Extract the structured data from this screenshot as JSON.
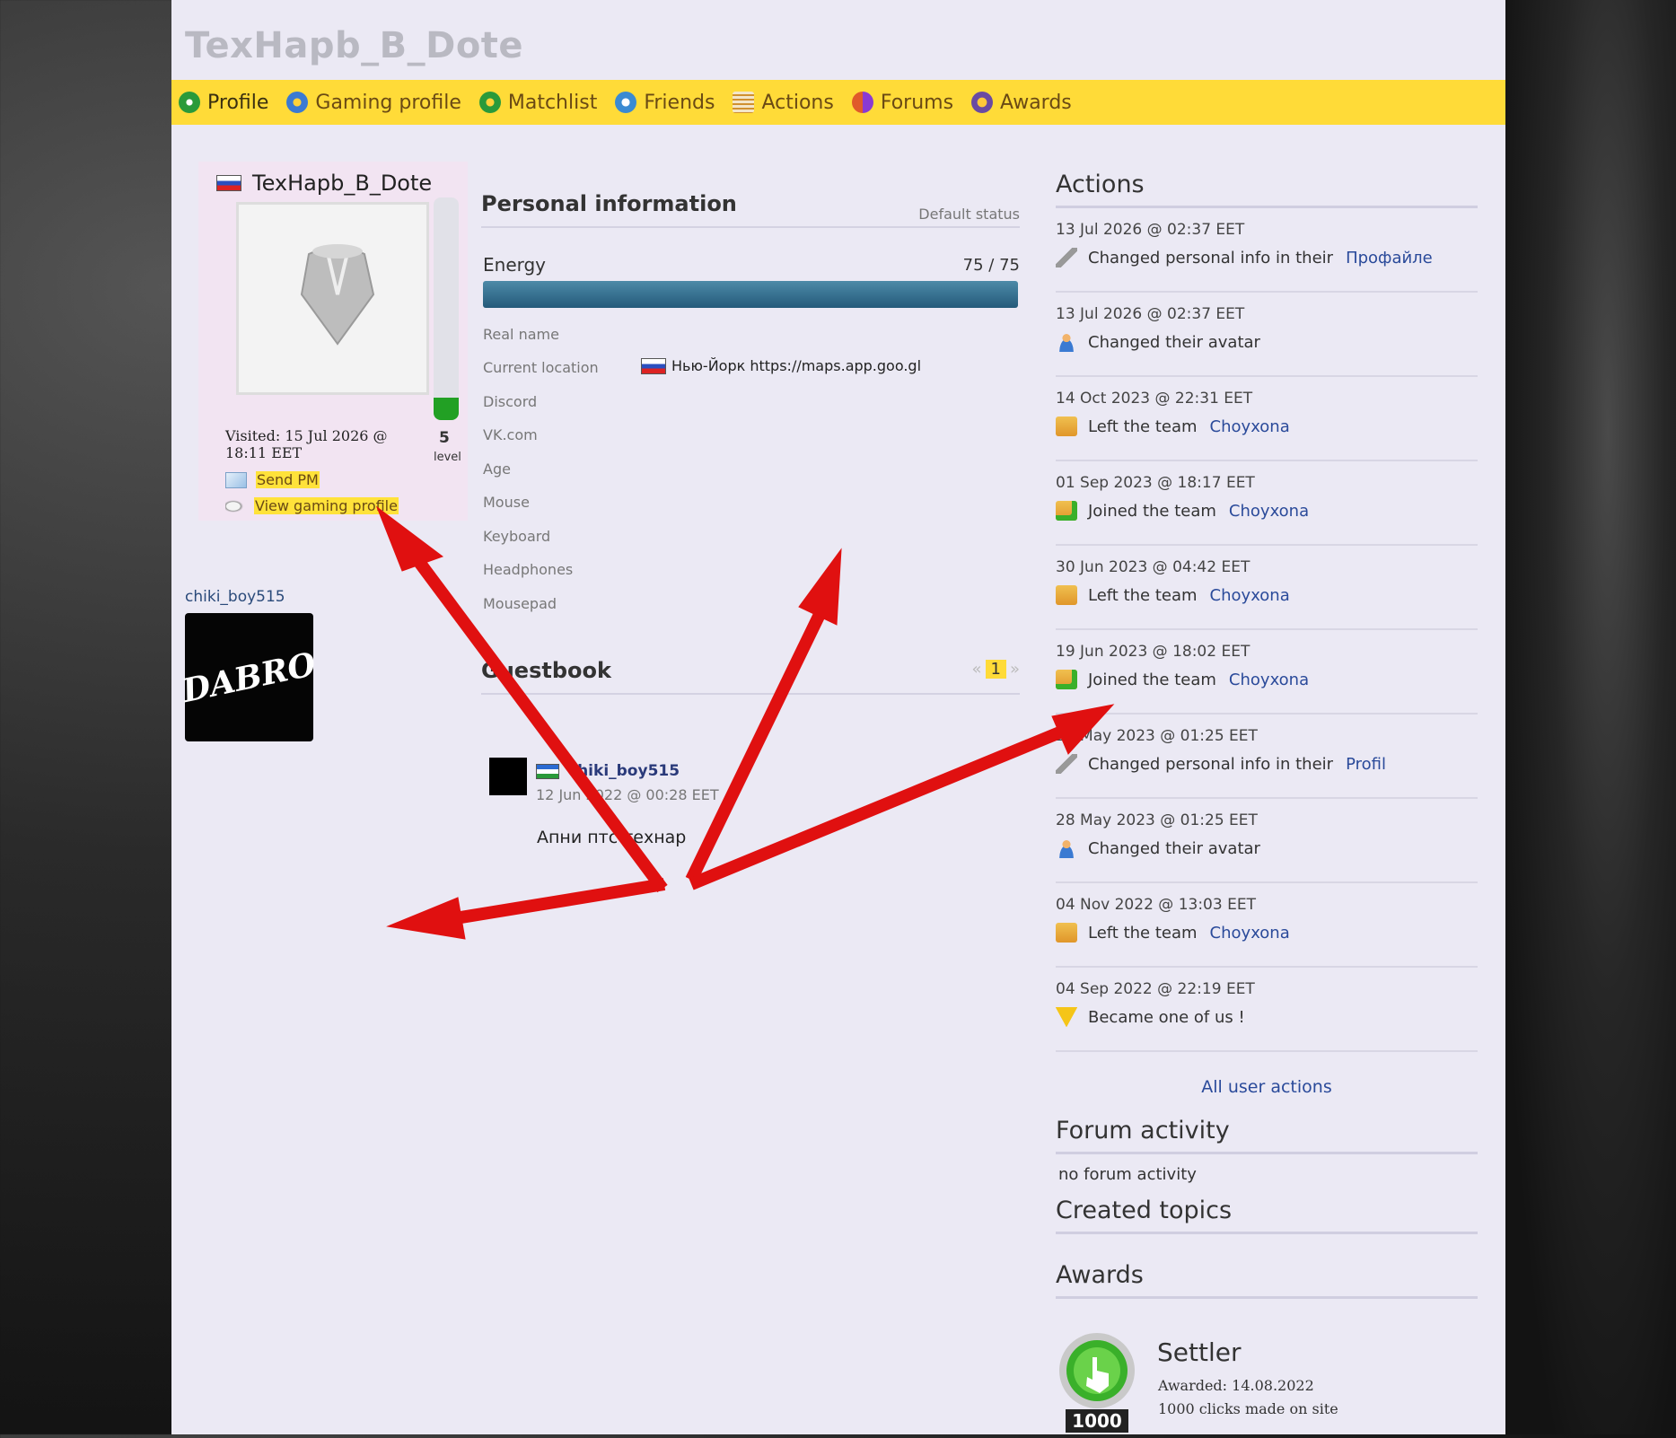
{
  "site_title": "TexHapb_B_Dote",
  "nav": [
    {
      "label": "Profile",
      "icon": "profile-icon"
    },
    {
      "label": "Gaming profile",
      "icon": "gaming-profile-icon"
    },
    {
      "label": "Matchlist",
      "icon": "matchlist-icon"
    },
    {
      "label": "Friends",
      "icon": "friends-icon"
    },
    {
      "label": "Actions",
      "icon": "actions-icon"
    },
    {
      "label": "Forums",
      "icon": "forums-icon"
    },
    {
      "label": "Awards",
      "icon": "awards-icon"
    }
  ],
  "profile": {
    "username": "TexHapb_B_Dote",
    "level": "5",
    "level_caption": "level",
    "level_fill_fraction": 0.1,
    "visited": "Visited: 15 Jul 2026 @ 18:11 EET",
    "send_pm": "Send PM",
    "view_gaming_profile": "View gaming profile"
  },
  "friend": {
    "name": "chiki_boy515",
    "avatar_text": "DABRO"
  },
  "personal": {
    "title": "Personal information",
    "status": "Default status",
    "energy_label": "Energy",
    "energy_value": "75 / 75",
    "energy_fraction": 1.0,
    "fields": [
      {
        "label": "Real name",
        "value": ""
      },
      {
        "label": "Current location",
        "value": "Нью-Йорк https://maps.app.goo.gl"
      },
      {
        "label": "Discord",
        "value": ""
      },
      {
        "label": "VK.com",
        "value": ""
      },
      {
        "label": "Age",
        "value": ""
      },
      {
        "label": "Mouse",
        "value": ""
      },
      {
        "label": "Keyboard",
        "value": ""
      },
      {
        "label": "Headphones",
        "value": ""
      },
      {
        "label": "Mousepad",
        "value": ""
      }
    ]
  },
  "guestbook": {
    "title": "Guestbook",
    "page_prev": "«",
    "page_current": "1",
    "page_next": "»",
    "entry": {
      "user": "chiki_boy515",
      "date": "12 Jun 2022 @ 00:28 EET",
      "text": "Апни птс технар"
    }
  },
  "actions": {
    "title": "Actions",
    "items": [
      {
        "date": "13 Jul 2026 @ 02:37 EET",
        "text": "Changed personal info in their",
        "link": "Профайле",
        "icon": "wrench-icon"
      },
      {
        "date": "13 Jul 2026 @ 02:37 EET",
        "text": "Changed their avatar",
        "link": "",
        "icon": "user-icon"
      },
      {
        "date": "14 Oct 2023 @ 22:31 EET",
        "text": "Left the team",
        "link": "Choyxona",
        "icon": "team-leave-icon"
      },
      {
        "date": "01 Sep 2023 @ 18:17 EET",
        "text": "Joined the team",
        "link": "Choyxona",
        "icon": "team-join-icon"
      },
      {
        "date": "30 Jun 2023 @ 04:42 EET",
        "text": "Left the team",
        "link": "Choyxona",
        "icon": "team-leave-icon"
      },
      {
        "date": "19 Jun 2023 @ 18:02 EET",
        "text": "Joined the team",
        "link": "Choyxona",
        "icon": "team-join-icon"
      },
      {
        "date": "28 May 2023 @ 01:25 EET",
        "text": "Changed personal info in their",
        "link": "Profil",
        "icon": "wrench-icon"
      },
      {
        "date": "28 May 2023 @ 01:25 EET",
        "text": "Changed their avatar",
        "link": "",
        "icon": "user-icon"
      },
      {
        "date": "04 Nov 2022 @ 13:03 EET",
        "text": "Left the team",
        "link": "Choyxona",
        "icon": "team-leave-icon"
      },
      {
        "date": "04 Sep 2022 @ 22:19 EET",
        "text": "Became one of us  !",
        "link": "",
        "icon": "warning-icon"
      }
    ],
    "all_link": "All user actions"
  },
  "forum": {
    "title": "Forum activity",
    "empty": "no forum activity",
    "created_topics_title": "Created topics"
  },
  "awards": {
    "title": "Awards",
    "item": {
      "name": "Settler",
      "awarded": "Awarded: 14.08.2022",
      "description": "1000 clicks made on site",
      "badge_number": "1000"
    }
  },
  "colors": {
    "nav_bg": "#ffdb38",
    "page_bg": "#ebe9f4",
    "link": "#2a4a9a",
    "arrow": "#e01010",
    "level_fill": "#22a024",
    "energy_fill": "#245a7a"
  }
}
